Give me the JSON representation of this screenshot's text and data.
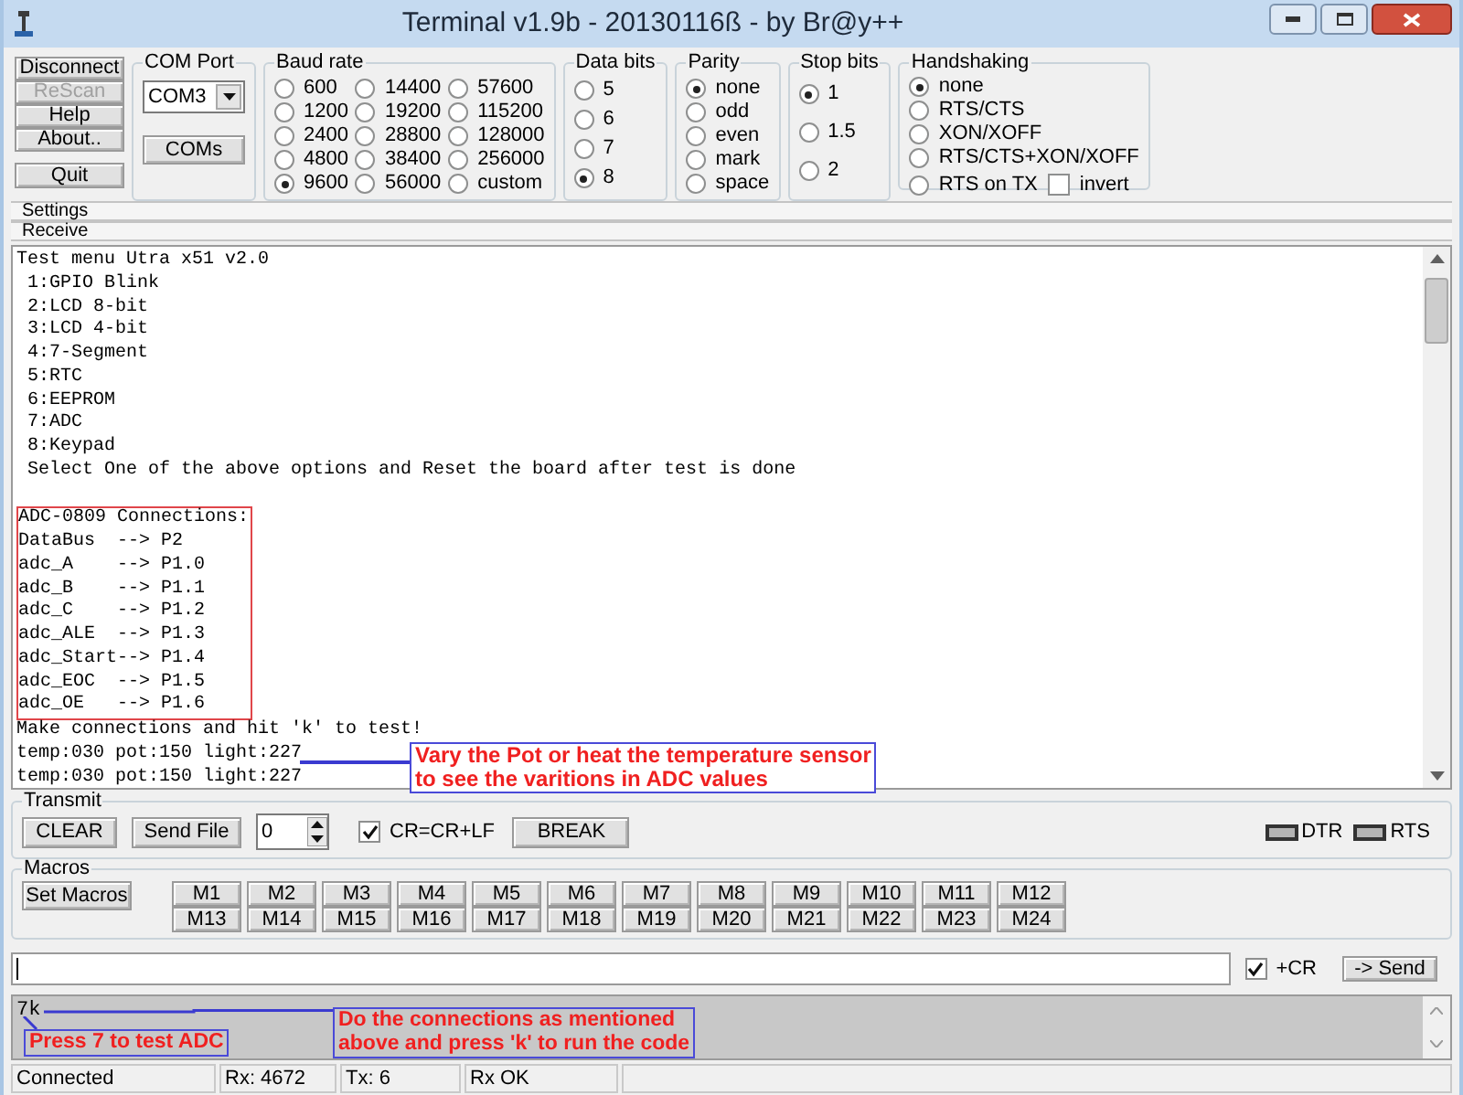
{
  "window": {
    "title": "Terminal v1.9b - 20130116ß - by Br@y++"
  },
  "settings": {
    "buttons": [
      {
        "label": "Disconnect",
        "disabled": false
      },
      {
        "label": "ReScan",
        "disabled": true
      },
      {
        "label": "Help",
        "disabled": false
      },
      {
        "label": "About..",
        "disabled": false
      },
      {
        "label": "Quit",
        "disabled": false
      }
    ],
    "com_port": {
      "title": "COM Port",
      "value": "COM3",
      "button": "COMs"
    },
    "baud_rate": {
      "title": "Baud rate",
      "options": [
        {
          "label": "600",
          "selected": false
        },
        {
          "label": "1200",
          "selected": false
        },
        {
          "label": "2400",
          "selected": false
        },
        {
          "label": "4800",
          "selected": false
        },
        {
          "label": "9600",
          "selected": true
        },
        {
          "label": "14400",
          "selected": false
        },
        {
          "label": "19200",
          "selected": false
        },
        {
          "label": "28800",
          "selected": false
        },
        {
          "label": "38400",
          "selected": false
        },
        {
          "label": "56000",
          "selected": false
        },
        {
          "label": "57600",
          "selected": false
        },
        {
          "label": "115200",
          "selected": false
        },
        {
          "label": "128000",
          "selected": false
        },
        {
          "label": "256000",
          "selected": false
        },
        {
          "label": "custom",
          "selected": false
        }
      ]
    },
    "data_bits": {
      "title": "Data bits",
      "options": [
        {
          "label": "5",
          "selected": false
        },
        {
          "label": "6",
          "selected": false
        },
        {
          "label": "7",
          "selected": false
        },
        {
          "label": "8",
          "selected": true
        }
      ]
    },
    "parity": {
      "title": "Parity",
      "options": [
        {
          "label": "none",
          "selected": true
        },
        {
          "label": "odd",
          "selected": false
        },
        {
          "label": "even",
          "selected": false
        },
        {
          "label": "mark",
          "selected": false
        },
        {
          "label": "space",
          "selected": false
        }
      ]
    },
    "stop_bits": {
      "title": "Stop bits",
      "options": [
        {
          "label": "1",
          "selected": true
        },
        {
          "label": "1.5",
          "selected": false
        },
        {
          "label": "2",
          "selected": false
        }
      ]
    },
    "handshaking": {
      "title": "Handshaking",
      "options": [
        {
          "label": "none",
          "selected": true
        },
        {
          "label": "RTS/CTS",
          "selected": false
        },
        {
          "label": "XON/XOFF",
          "selected": false
        },
        {
          "label": "RTS/CTS+XON/XOFF",
          "selected": false
        },
        {
          "label": "RTS on TX",
          "selected": false
        }
      ],
      "invert": {
        "label": "invert",
        "checked": false
      }
    }
  },
  "settings_bar": "Settings",
  "receive_bar": "Receive",
  "receive": {
    "menu_lines": [
      "Test menu Utra x51 v2.0",
      " 1:GPIO Blink",
      " 2:LCD 8-bit",
      " 3:LCD 4-bit",
      " 4:7-Segment",
      " 5:RTC",
      " 6:EEPROM",
      " 7:ADC",
      " 8:Keypad",
      " Select One of the above options and Reset the board after test is done"
    ],
    "connection_lines": [
      "ADC-0809 Connections:",
      "DataBus  --> P2",
      "adc_A    --> P1.0",
      "adc_B    --> P1.1",
      "adc_C    --> P1.2",
      "adc_ALE  --> P1.3",
      "adc_Start--> P1.4",
      "adc_EOC  --> P1.5",
      "adc_OE   --> P1.6"
    ],
    "output_lines": [
      "Make connections and hit 'k' to test!",
      "temp:030 pot:150 light:227",
      "temp:030 pot:150 light:227"
    ],
    "annotation": [
      "Vary the Pot or heat the temperature sensor",
      "to see the varitions in ADC values"
    ]
  },
  "transmit": {
    "title": "Transmit",
    "buttons": [
      "CLEAR",
      "Send File"
    ],
    "repeat_value": "0",
    "cr_lf": {
      "label": "CR=CR+LF",
      "checked": true
    },
    "break_button": "BREAK",
    "indicators": [
      {
        "label": "DTR",
        "on": false
      },
      {
        "label": "RTS",
        "on": false
      }
    ]
  },
  "macros": {
    "title": "Macros",
    "set_button": "Set Macros",
    "buttons": [
      "M1",
      "M2",
      "M3",
      "M4",
      "M5",
      "M6",
      "M7",
      "M8",
      "M9",
      "M10",
      "M11",
      "M12",
      "M13",
      "M14",
      "M15",
      "M16",
      "M17",
      "M18",
      "M19",
      "M20",
      "M21",
      "M22",
      "M23",
      "M24"
    ]
  },
  "input": {
    "plus_cr": {
      "label": "+CR",
      "checked": true
    },
    "send_button": "-> Send"
  },
  "output": {
    "text": "7k",
    "annotations": [
      {
        "lines": [
          "Press 7 to test ADC"
        ]
      },
      {
        "lines": [
          "Do the connections as mentioned",
          "above and press 'k' to run the code"
        ]
      }
    ]
  },
  "status_bar": [
    "Connected",
    "Rx: 4672",
    "Tx: 6",
    "Rx OK"
  ]
}
